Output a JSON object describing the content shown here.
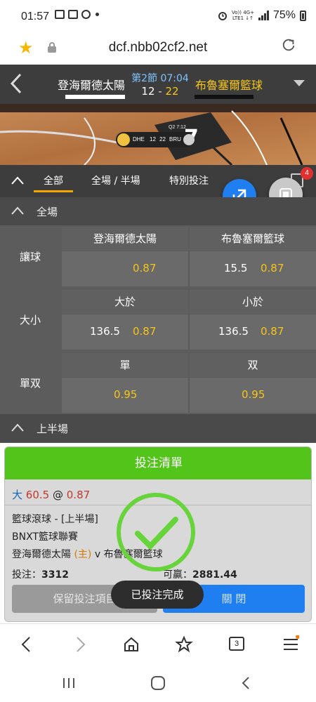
{
  "status": {
    "time": "01:57",
    "net_top": "Vo)) 4G+",
    "net_bottom": "LTE1 ↓↑",
    "battery": "75%"
  },
  "browser": {
    "url": "dcf.nbb02cf2.net"
  },
  "game": {
    "home_team": "登海爾德太陽",
    "away_team": "布魯塞爾籃球",
    "period": "第2節 07:04",
    "home_score": "12",
    "separator": "-",
    "away_score": "22"
  },
  "scoreboard": {
    "home_abbr": "DHE",
    "home_score": "12",
    "away_score": "22",
    "away_abbr": "BRU",
    "period": "Q2",
    "clock": "7:12"
  },
  "tabs": [
    {
      "label": "全部",
      "active": true
    },
    {
      "label": "全場 / 半場",
      "active": false
    },
    {
      "label": "特別投注",
      "active": false
    }
  ],
  "notification_count": "4",
  "sections": {
    "full_game": "全場",
    "first_half": "上半場"
  },
  "markets": {
    "handicap": {
      "label": "讓球",
      "home_header": "登海爾德太陽",
      "away_header": "布魯塞爾籃球",
      "home_line": "",
      "home_odds": "0.87",
      "away_line": "15.5",
      "away_odds": "0.87"
    },
    "total": {
      "label": "大小",
      "over_header": "大於",
      "under_header": "小於",
      "over_line": "136.5",
      "over_odds": "0.87",
      "under_line": "136.5",
      "under_odds": "0.87"
    },
    "odd_even": {
      "label": "單双",
      "odd_header": "單",
      "even_header": "双",
      "odd_odds": "0.95",
      "even_odds": "0.95"
    }
  },
  "betslip": {
    "title": "投注清單",
    "selection": "大",
    "line": "60.5",
    "at": "@",
    "odds": "0.87",
    "market": "籃球滾球 - [上半場]",
    "league": "BNXT籃球聯賽",
    "home": "登海爾德太陽",
    "home_tag": "(主)",
    "vs": "v",
    "away": "布魯塞爾籃球",
    "stake_label": "投注：",
    "stake": "3312",
    "win_label": "可贏：",
    "win": "2881.44",
    "keep_button": "保留投注項目",
    "close_button": "關 閉"
  },
  "toast": "已投注完成",
  "bottom_nav": {
    "tabs_count": "3"
  },
  "colors": {
    "accent_orange": "#f5a400",
    "odds_yellow": "#f5c518",
    "fab_blue": "#1f7ef0",
    "slip_green": "#52c41a",
    "check_green": "#66d43a"
  }
}
